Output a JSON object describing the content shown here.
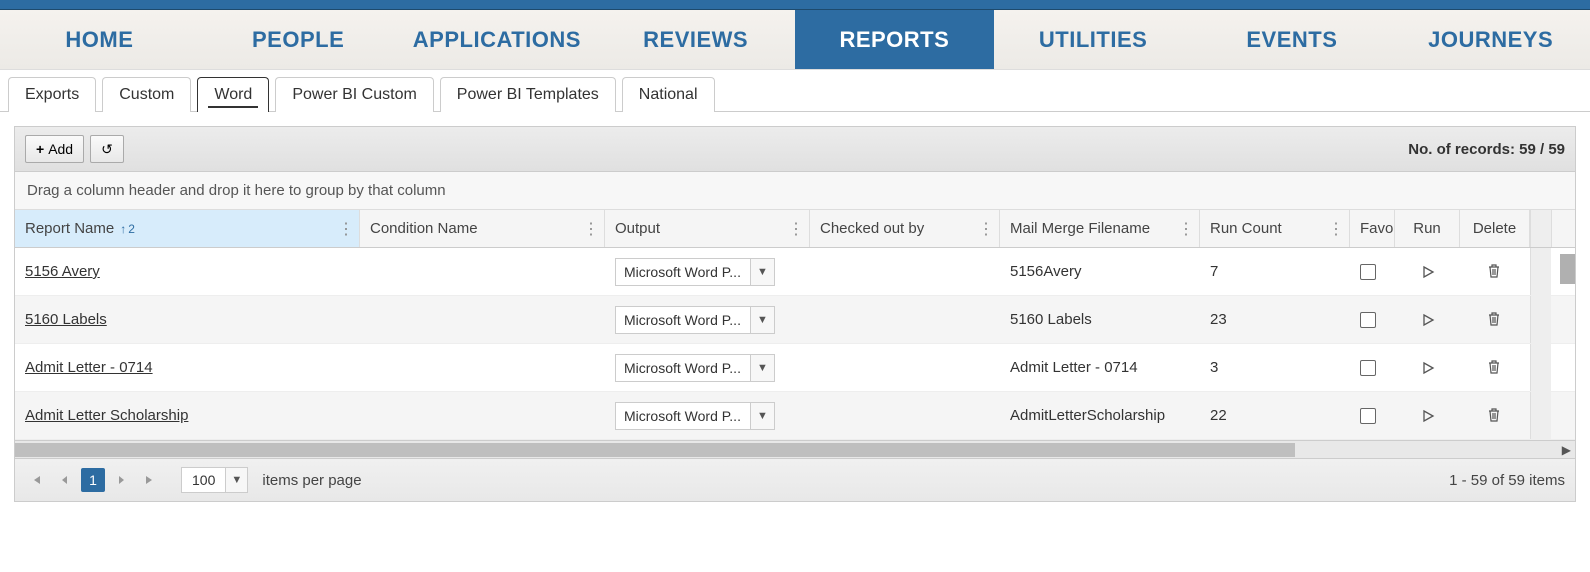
{
  "nav": {
    "items": [
      "HOME",
      "PEOPLE",
      "APPLICATIONS",
      "REVIEWS",
      "REPORTS",
      "UTILITIES",
      "EVENTS",
      "JOURNEYS"
    ],
    "active_index": 4
  },
  "sub_tabs": {
    "items": [
      "Exports",
      "Custom",
      "Word",
      "Power BI Custom",
      "Power BI Templates",
      "National"
    ],
    "active_index": 2
  },
  "toolbar": {
    "add_label": "Add",
    "records_label": "No. of records: 59 / 59"
  },
  "group_hint": "Drag a column header and drop it here to group by that column",
  "columns": {
    "report_name": "Report Name",
    "condition_name": "Condition Name",
    "output": "Output",
    "checked_out_by": "Checked out by",
    "mail_merge_filename": "Mail Merge Filename",
    "run_count": "Run Count",
    "favorite": "Favo",
    "run": "Run",
    "delete": "Delete",
    "sort_order": "2"
  },
  "rows": [
    {
      "report_name": "5156 Avery",
      "condition_name": "",
      "output": "Microsoft Word P...",
      "checked_out_by": "",
      "mail_merge_filename": "5156Avery",
      "run_count": "7"
    },
    {
      "report_name": "5160 Labels",
      "condition_name": "",
      "output": "Microsoft Word P...",
      "checked_out_by": "",
      "mail_merge_filename": "5160 Labels",
      "run_count": "23"
    },
    {
      "report_name": "Admit Letter - 0714",
      "condition_name": "",
      "output": "Microsoft Word P...",
      "checked_out_by": "",
      "mail_merge_filename": "Admit Letter - 0714",
      "run_count": "3"
    },
    {
      "report_name": "Admit Letter Scholarship",
      "condition_name": "",
      "output": "Microsoft Word P...",
      "checked_out_by": "",
      "mail_merge_filename": "AdmitLetterScholarship",
      "run_count": "22"
    }
  ],
  "pager": {
    "current_page": "1",
    "page_size": "100",
    "items_per_page_label": "items per page",
    "summary": "1 - 59 of 59 items"
  }
}
